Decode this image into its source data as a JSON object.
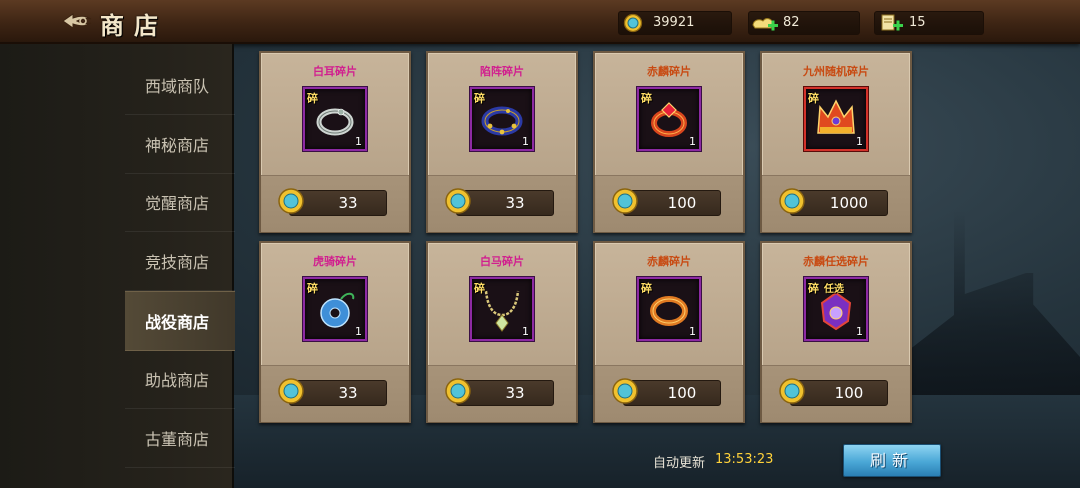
{
  "header": {
    "title": "商店",
    "resources": [
      {
        "icon": "gold-coin-icon",
        "value": "39921"
      },
      {
        "icon": "silver-ingot-plus-icon",
        "value": "82"
      },
      {
        "icon": "scroll-plus-icon",
        "value": "15"
      }
    ]
  },
  "sidebar": {
    "items": [
      {
        "label": "西域商队",
        "active": false
      },
      {
        "label": "神秘商店",
        "active": false
      },
      {
        "label": "觉醒商店",
        "active": false
      },
      {
        "label": "竞技商店",
        "active": false
      },
      {
        "label": "战役商店",
        "active": true
      },
      {
        "label": "助战商店",
        "active": false
      },
      {
        "label": "古董商店",
        "active": false
      }
    ]
  },
  "items": [
    {
      "name": "白耳碎片",
      "name_color": "#d11f8f",
      "badge": "碎",
      "qty": "1",
      "price": "33",
      "icon": "silver-ring-icon"
    },
    {
      "name": "陷阵碎片",
      "name_color": "#d11f8f",
      "badge": "碎",
      "qty": "1",
      "price": "33",
      "icon": "blue-gem-bracelet-icon"
    },
    {
      "name": "赤麟碎片",
      "name_color": "#c84a12",
      "badge": "碎",
      "qty": "1",
      "price": "100",
      "icon": "red-gem-ring-icon"
    },
    {
      "name": "九州随机碎片",
      "name_color": "#c84a12",
      "badge": "碎",
      "qty": "1",
      "price": "1000",
      "icon": "golden-crown-icon"
    },
    {
      "name": "虎骑碎片",
      "name_color": "#d11f8f",
      "badge": "碎",
      "qty": "1",
      "price": "33",
      "icon": "blue-jade-pendant-icon"
    },
    {
      "name": "白马碎片",
      "name_color": "#d11f8f",
      "badge": "碎",
      "qty": "1",
      "price": "33",
      "icon": "gold-necklace-icon"
    },
    {
      "name": "赤麟碎片",
      "name_color": "#c84a12",
      "badge": "碎",
      "qty": "1",
      "price": "100",
      "icon": "gold-bangle-icon"
    },
    {
      "name": "赤麟任选碎片",
      "name_color": "#c84a12",
      "badge": "碎",
      "select_badge": "任选",
      "qty": "1",
      "price": "100",
      "icon": "purple-crest-icon"
    }
  ],
  "footer": {
    "refresh_label": "自动更新",
    "refresh_time": "13:53:23",
    "refresh_button": "刷新"
  },
  "colors": {
    "purple_name": "#d11f8f",
    "orange_name": "#c84a12",
    "time_yellow": "#ffd23a",
    "refresh_blue": "#4aa7d6"
  }
}
